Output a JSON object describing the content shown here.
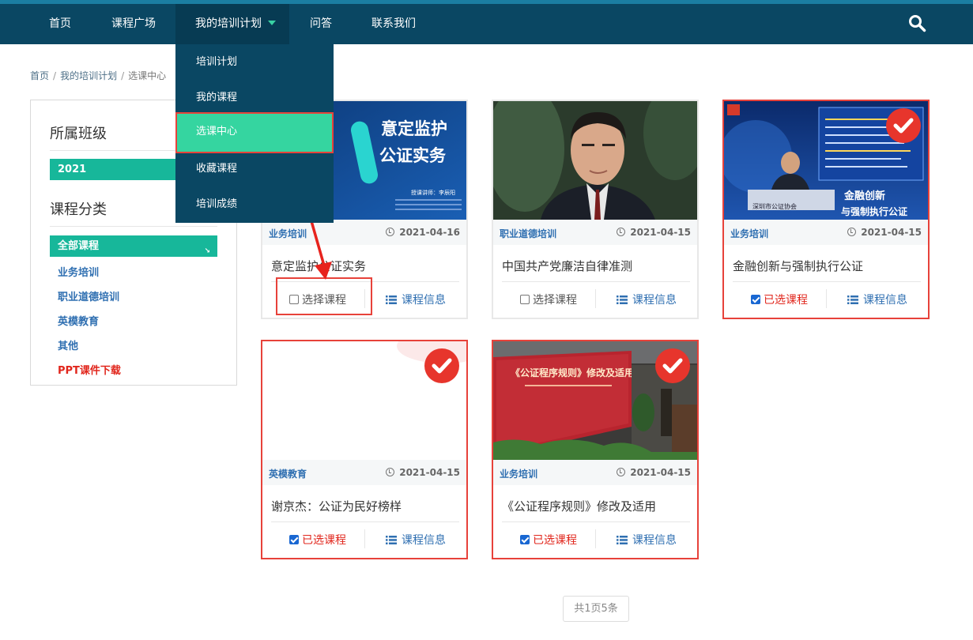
{
  "nav": {
    "items": [
      {
        "label": "首页"
      },
      {
        "label": "课程广场"
      },
      {
        "label": "我的培训计划"
      },
      {
        "label": "问答"
      },
      {
        "label": "联系我们"
      }
    ],
    "dropdown": [
      {
        "label": "培训计划"
      },
      {
        "label": "我的课程"
      },
      {
        "label": "选课中心"
      },
      {
        "label": "收藏课程"
      },
      {
        "label": "培训成绩"
      }
    ]
  },
  "breadcrumb": {
    "home": "首页",
    "plan": "我的培训计划",
    "current": "选课中心"
  },
  "sidebar": {
    "class_title": "所属班级",
    "class_value": "2021",
    "category_title": "课程分类",
    "categories": [
      {
        "label": "全部课程"
      },
      {
        "label": "业务培训"
      },
      {
        "label": "职业道德培训"
      },
      {
        "label": "英模教育"
      },
      {
        "label": "其他"
      },
      {
        "label": "PPT课件下载"
      }
    ]
  },
  "courses": [
    {
      "title": "意定监护公证实务",
      "category": "业务培训",
      "date": "2021-04-16",
      "action": "选择课程",
      "info": "课程信息",
      "selected": false,
      "thumb_text": {
        "line1": "意定监护",
        "line2": "公证实务",
        "lecturer": "授课讲师：李辰阳"
      }
    },
    {
      "title": "中国共产党廉洁自律准测",
      "category": "职业道德培训",
      "date": "2021-04-15",
      "action": "选择课程",
      "info": "课程信息",
      "selected": false
    },
    {
      "title": "金融创新与强制执行公证",
      "category": "业务培训",
      "date": "2021-04-15",
      "action": "已选课程",
      "info": "课程信息",
      "selected": true,
      "thumb_text": {
        "line1": "金融创新",
        "line2": "与强制执行公证",
        "org": "深圳市公证协会"
      }
    },
    {
      "title": "谢京杰：公证为民好榜样",
      "category": "英模教育",
      "date": "2021-04-15",
      "action": "已选课程",
      "info": "课程信息",
      "selected": true
    },
    {
      "title": "《公证程序规则》修改及适用",
      "category": "业务培训",
      "date": "2021-04-15",
      "action": "已选课程",
      "info": "课程信息",
      "selected": true,
      "thumb_text": {
        "line1": "《公证程序规则》修改及适用"
      }
    }
  ],
  "pager": {
    "label": "共1页5条"
  },
  "colors": {
    "nav": "#0a4763",
    "accent": "#17b79a",
    "highlight": "#e7423a",
    "link": "#2f6fb1"
  }
}
